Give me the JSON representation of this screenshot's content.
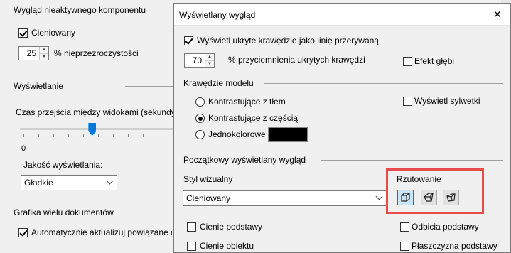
{
  "background": {
    "component_section_title": "Wygląd nieaktywnego komponentu",
    "shaded_label": "Cieniowany",
    "opacity_value": "25",
    "opacity_label": "% nieprzezroczystości",
    "display_section_title": "Wyświetlanie",
    "transition_label": "Czas przejścia między widokami (sekundy)",
    "slider_min_label": "0",
    "slider_fraction": 0.47,
    "quality_label": "Jakość wyświetlania:",
    "quality_value": "Gładkie",
    "multidoc_section_title": "Grafika wielu dokumentów",
    "auto_update_label": "Automatycznie aktualizuj powiązane o"
  },
  "dialog": {
    "title": "Wyświetlany wygląd",
    "close_glyph": "✕",
    "show_hidden_edges_label": "Wyświetl ukryte krawędzie jako linię przerywaną",
    "hidden_dim_value": "70",
    "hidden_dim_label": "% przyciemnienia ukrytych krawędzi",
    "depth_effect_label": "Efekt głębi",
    "model_edges_title": "Krawędzie modelu",
    "radio_contrast_bg": "Kontrastujące z tłem",
    "radio_contrast_part": "Kontrastujące z częścią",
    "radio_single_color": "Jednokolorowe",
    "single_color_swatch": "#000000",
    "show_silhouettes_label": "Wyświetl sylwetki",
    "initial_view_title": "Początkowy wyświetlany wygląd",
    "visual_style_label": "Styl wizualny",
    "visual_style_value": "Cieniowany",
    "projection_label": "Rzutowanie",
    "highlight_color": "#e94b4b",
    "ground_shadows_label": "Cienie podstawy",
    "ground_reflections_label": "Odbicia podstawy",
    "object_shadows_label": "Cienie obiektu",
    "ground_plane_label": "Płaszczyzna podstawy"
  }
}
